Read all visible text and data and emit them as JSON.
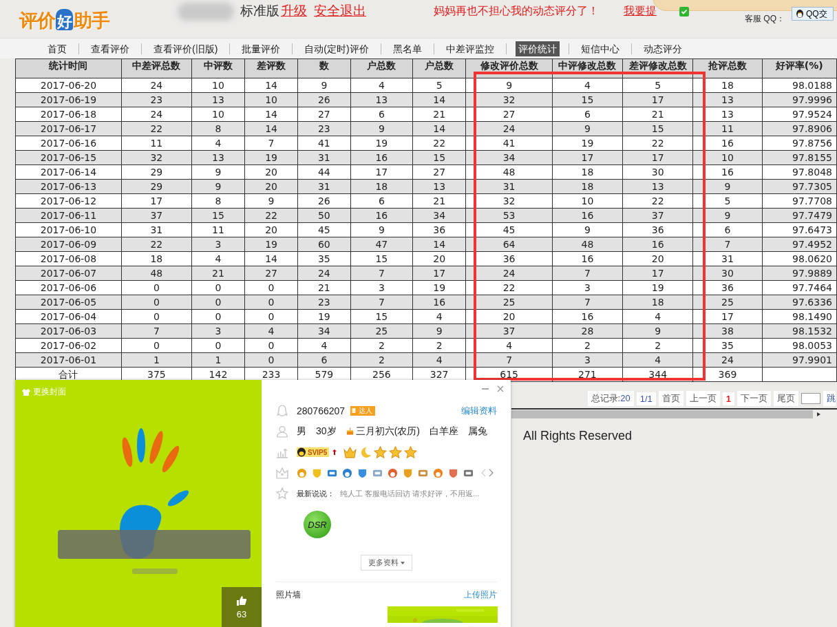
{
  "header": {
    "logo_parts": [
      "评价",
      "好",
      "助手"
    ],
    "edition": "标准版",
    "upgrade_link": "升级",
    "logout_link": "安全退出",
    "slogan": "妈妈再也不担心我的动态评分了！",
    "promo_link": "我要提",
    "support_label": "客服 QQ：",
    "qq_button": "QQ交"
  },
  "nav": [
    {
      "label": "首页",
      "selected": false
    },
    {
      "label": "查看评价",
      "selected": false
    },
    {
      "label": "查看评价(旧版)",
      "selected": false
    },
    {
      "label": "批量评价",
      "selected": false
    },
    {
      "label": "自动(定时)评价",
      "selected": false
    },
    {
      "label": "黑名单",
      "selected": false
    },
    {
      "label": "中差评监控",
      "selected": false
    },
    {
      "label": "评价统计",
      "selected": true
    },
    {
      "label": "短信中心",
      "selected": false
    },
    {
      "label": "动态评分",
      "selected": false
    }
  ],
  "table": {
    "columns": [
      {
        "label": "统计时间",
        "highlighted": false
      },
      {
        "label": "中差评总数",
        "highlighted": false
      },
      {
        "label": "中评数",
        "highlighted": false
      },
      {
        "label": "差评数",
        "highlighted": false
      },
      {
        "label": "数",
        "highlighted": false
      },
      {
        "label": "户总数",
        "highlighted": false
      },
      {
        "label": "户总数",
        "highlighted": false
      },
      {
        "label": "修改评价总数",
        "highlighted": true
      },
      {
        "label": "中评修改总数",
        "highlighted": true
      },
      {
        "label": "差评修改总数",
        "highlighted": true
      },
      {
        "label": "抢评总数",
        "highlighted": false
      },
      {
        "label": "好评率(%)",
        "highlighted": false
      }
    ],
    "rows": [
      [
        "2017-06-20",
        "24",
        "10",
        "14",
        "9",
        "4",
        "5",
        "9",
        "4",
        "5",
        "18",
        "98.0188"
      ],
      [
        "2017-06-19",
        "23",
        "13",
        "10",
        "26",
        "13",
        "14",
        "32",
        "15",
        "17",
        "13",
        "97.9996"
      ],
      [
        "2017-06-18",
        "24",
        "10",
        "14",
        "27",
        "6",
        "21",
        "27",
        "6",
        "21",
        "13",
        "97.9524"
      ],
      [
        "2017-06-17",
        "22",
        "8",
        "14",
        "23",
        "9",
        "14",
        "24",
        "9",
        "15",
        "11",
        "97.8906"
      ],
      [
        "2017-06-16",
        "11",
        "4",
        "7",
        "41",
        "19",
        "22",
        "41",
        "19",
        "22",
        "16",
        "97.8756"
      ],
      [
        "2017-06-15",
        "32",
        "13",
        "19",
        "31",
        "16",
        "15",
        "34",
        "17",
        "17",
        "10",
        "97.8155"
      ],
      [
        "2017-06-14",
        "29",
        "9",
        "20",
        "44",
        "17",
        "27",
        "48",
        "18",
        "30",
        "16",
        "97.8048"
      ],
      [
        "2017-06-13",
        "29",
        "9",
        "20",
        "31",
        "18",
        "13",
        "31",
        "18",
        "13",
        "9",
        "97.7305"
      ],
      [
        "2017-06-12",
        "17",
        "8",
        "9",
        "26",
        "6",
        "21",
        "32",
        "10",
        "22",
        "5",
        "97.7708"
      ],
      [
        "2017-06-11",
        "37",
        "15",
        "22",
        "50",
        "16",
        "34",
        "53",
        "16",
        "37",
        "9",
        "97.7479"
      ],
      [
        "2017-06-10",
        "31",
        "11",
        "20",
        "45",
        "9",
        "36",
        "45",
        "9",
        "36",
        "6",
        "97.6473"
      ],
      [
        "2017-06-09",
        "22",
        "3",
        "19",
        "60",
        "47",
        "14",
        "64",
        "48",
        "16",
        "7",
        "97.4952"
      ],
      [
        "2017-06-08",
        "18",
        "4",
        "14",
        "35",
        "15",
        "20",
        "36",
        "16",
        "20",
        "31",
        "98.0620"
      ],
      [
        "2017-06-07",
        "48",
        "21",
        "27",
        "24",
        "7",
        "17",
        "24",
        "7",
        "17",
        "30",
        "97.9889"
      ],
      [
        "2017-06-06",
        "0",
        "0",
        "0",
        "21",
        "3",
        "19",
        "22",
        "3",
        "19",
        "36",
        "97.7464"
      ],
      [
        "2017-06-05",
        "0",
        "0",
        "0",
        "23",
        "7",
        "16",
        "25",
        "7",
        "18",
        "25",
        "97.6336"
      ],
      [
        "2017-06-04",
        "0",
        "0",
        "0",
        "19",
        "15",
        "4",
        "20",
        "16",
        "4",
        "17",
        "98.1490"
      ],
      [
        "2017-06-03",
        "7",
        "3",
        "4",
        "34",
        "25",
        "9",
        "37",
        "28",
        "9",
        "38",
        "98.1532"
      ],
      [
        "2017-06-02",
        "0",
        "0",
        "0",
        "4",
        "2",
        "2",
        "4",
        "2",
        "2",
        "35",
        "98.0053"
      ],
      [
        "2017-06-01",
        "1",
        "1",
        "0",
        "6",
        "2",
        "4",
        "7",
        "3",
        "4",
        "24",
        "97.9901"
      ]
    ],
    "total_row": [
      "合计",
      "375",
      "142",
      "233",
      "579",
      "256",
      "327",
      "615",
      "271",
      "344",
      "369"
    ]
  },
  "pagination": {
    "total_label": "总记录:",
    "total": "20",
    "pages": "1/1",
    "first": "首页",
    "prev": "上一页",
    "current": "1",
    "next": "下一页",
    "last": "尾页",
    "jump": "跳"
  },
  "footer": "All Rights Reserved",
  "profile_card": {
    "change_cover": "更换封面",
    "likes": "63",
    "qq_number": "280766207",
    "talent_badge": "达人",
    "edit_link": "编辑资料",
    "gender": "男",
    "age": "30岁",
    "birthday": "三月初六(农历)",
    "zodiac": "白羊座",
    "animal_sign": "属兔",
    "vip_badge": "SVIP5",
    "status_label": "最新说说：",
    "status_text": "纯人工 客服电话回访 请求好评，不用返...",
    "dsr_badge": "DSR",
    "more_button": "更多资料",
    "photo_wall": "照片墙",
    "upload_link": "上传照片"
  }
}
